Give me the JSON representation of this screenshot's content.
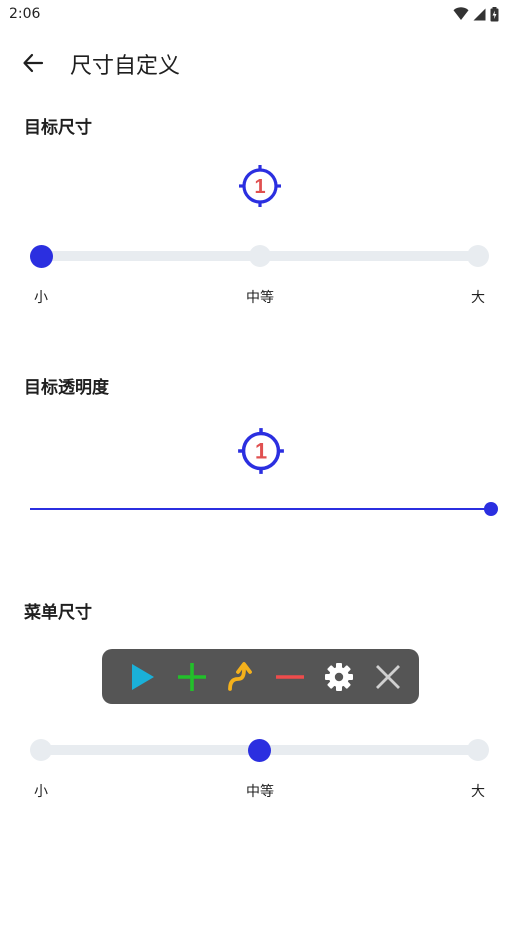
{
  "status": {
    "time": "2:06"
  },
  "appbar": {
    "title": "尺寸自定义"
  },
  "sections": {
    "target_size": {
      "title": "目标尺寸",
      "icon_number": "1",
      "levels": [
        "小",
        "中等",
        "大"
      ],
      "selected_index": 0
    },
    "target_opacity": {
      "title": "目标透明度",
      "icon_number": "1",
      "value_fraction": 1.0
    },
    "menu_size": {
      "title": "菜单尺寸",
      "icons": [
        "play-icon",
        "plus-icon",
        "curved-arrow-icon",
        "minus-icon",
        "gear-icon",
        "close-icon"
      ],
      "levels": [
        "小",
        "中等",
        "大"
      ],
      "selected_index": 1
    }
  },
  "colors": {
    "accent": "#2b2fe0",
    "track": "#e8ecf0",
    "target_number": "#e05050",
    "menu_bg": "#555555",
    "play": "#1ab0d8",
    "plus": "#22c02a",
    "arrow": "#f4b11c",
    "minus": "#ef4c4c",
    "gear": "#ffffff",
    "close": "#d0d0d0"
  }
}
